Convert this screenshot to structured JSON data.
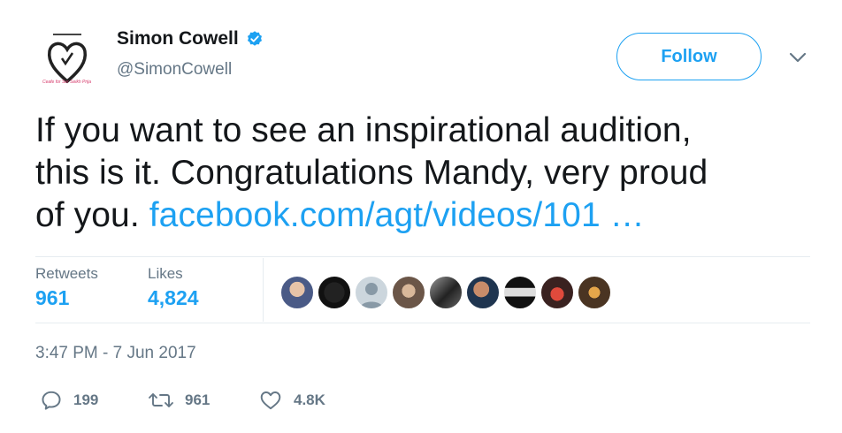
{
  "profile": {
    "name": "Simon Cowell",
    "handle": "@SimonCowell",
    "avatar_caption": "Ceafe for Ser Seikh Prija"
  },
  "follow_label": "Follow",
  "tweet": {
    "line1": "If you want to see an inspirational audition,",
    "line2": "this is it. Congratulations Mandy, very proud",
    "line3_prefix": "of you.",
    "link": "facebook.com/agt/videos/101 …"
  },
  "stats": {
    "retweets_label": "Retweets",
    "retweets_value": "961",
    "likes_label": "Likes",
    "likes_value": "4,824"
  },
  "timestamp": "3:47 PM - 7 Jun 2017",
  "actions": {
    "replies": "199",
    "retweets": "961",
    "likes": "4.8K"
  },
  "colors": {
    "accent": "#1da1f2",
    "text": "#14171a",
    "muted": "#657786",
    "divider": "#e6ecf0"
  },
  "icons": [
    "verified-badge-icon",
    "chevron-down-icon",
    "reply-icon",
    "retweet-icon",
    "like-heart-icon"
  ]
}
